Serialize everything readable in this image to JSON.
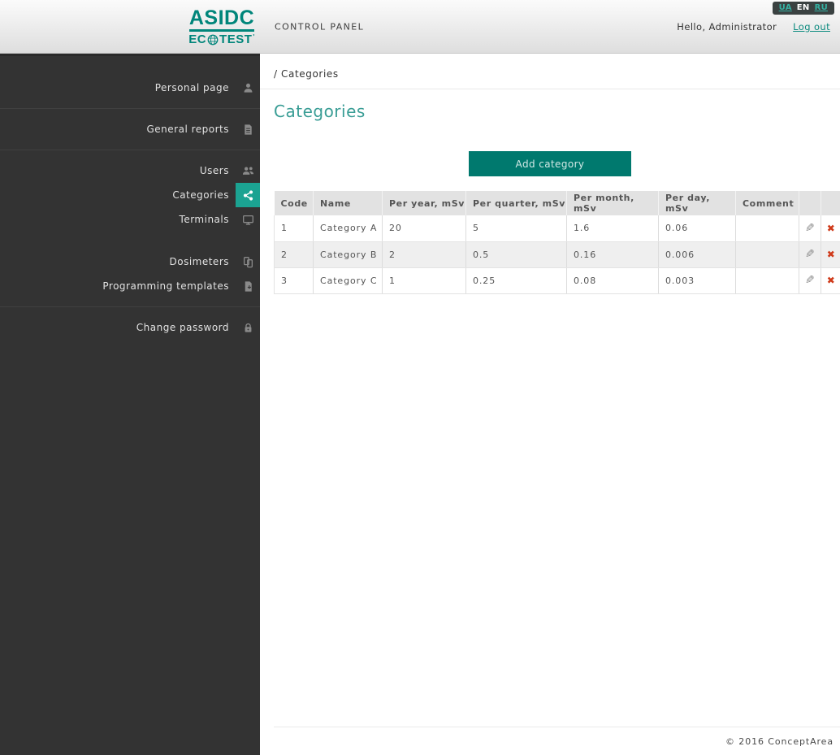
{
  "header": {
    "logo": {
      "top": "ASIDC",
      "bottom_left": "EC",
      "bottom_right": "TEST",
      "trademark": "'"
    },
    "control_panel_label": "CONTROL PANEL",
    "greeting": "Hello, Administrator",
    "logout_label": "Log out",
    "languages": [
      {
        "code": "UA",
        "active": false
      },
      {
        "code": "EN",
        "active": true
      },
      {
        "code": "RU",
        "active": false
      }
    ]
  },
  "sidebar": {
    "items": [
      {
        "label": "Personal page",
        "icon": "person-icon"
      },
      {
        "label": "General reports",
        "icon": "report-icon"
      },
      {
        "label": "Users",
        "icon": "users-icon"
      },
      {
        "label": "Categories",
        "icon": "share-icon",
        "active": true
      },
      {
        "label": "Terminals",
        "icon": "monitor-icon"
      },
      {
        "label": "Dosimeters",
        "icon": "dosimeter-icon"
      },
      {
        "label": "Programming templates",
        "icon": "template-icon"
      },
      {
        "label": "Change password",
        "icon": "lock-icon"
      }
    ]
  },
  "main": {
    "breadcrumb": "/ Categories",
    "title": "Categories",
    "add_button_label": "Add category",
    "table": {
      "columns": [
        "Code",
        "Name",
        "Per year, mSv",
        "Per quarter, mSv",
        "Per month, mSv",
        "Per day, mSv",
        "Comment"
      ],
      "rows": [
        {
          "code": "1",
          "name": "Category A",
          "per_year": "20",
          "per_quarter": "5",
          "per_month": "1.6",
          "per_day": "0.06",
          "comment": ""
        },
        {
          "code": "2",
          "name": "Category B",
          "per_year": "2",
          "per_quarter": "0.5",
          "per_month": "0.16",
          "per_day": "0.006",
          "comment": ""
        },
        {
          "code": "3",
          "name": "Category C",
          "per_year": "1",
          "per_quarter": "0.25",
          "per_month": "0.08",
          "per_day": "0.003",
          "comment": ""
        }
      ]
    }
  },
  "icons": {
    "edit_glyph": "✎",
    "delete_glyph": "✖"
  },
  "footer": {
    "copyright": "© 2016 ConceptArea"
  },
  "colors": {
    "accent_teal": "#00796e",
    "active_item_teal": "#1ba392",
    "heading_teal": "#399d95",
    "logo_teal": "#00857a",
    "delete_red": "#cf3a1a",
    "sidebar_bg": "#333333",
    "table_header_bg": "#e2e2e2",
    "alt_row_bg": "#efefef"
  }
}
